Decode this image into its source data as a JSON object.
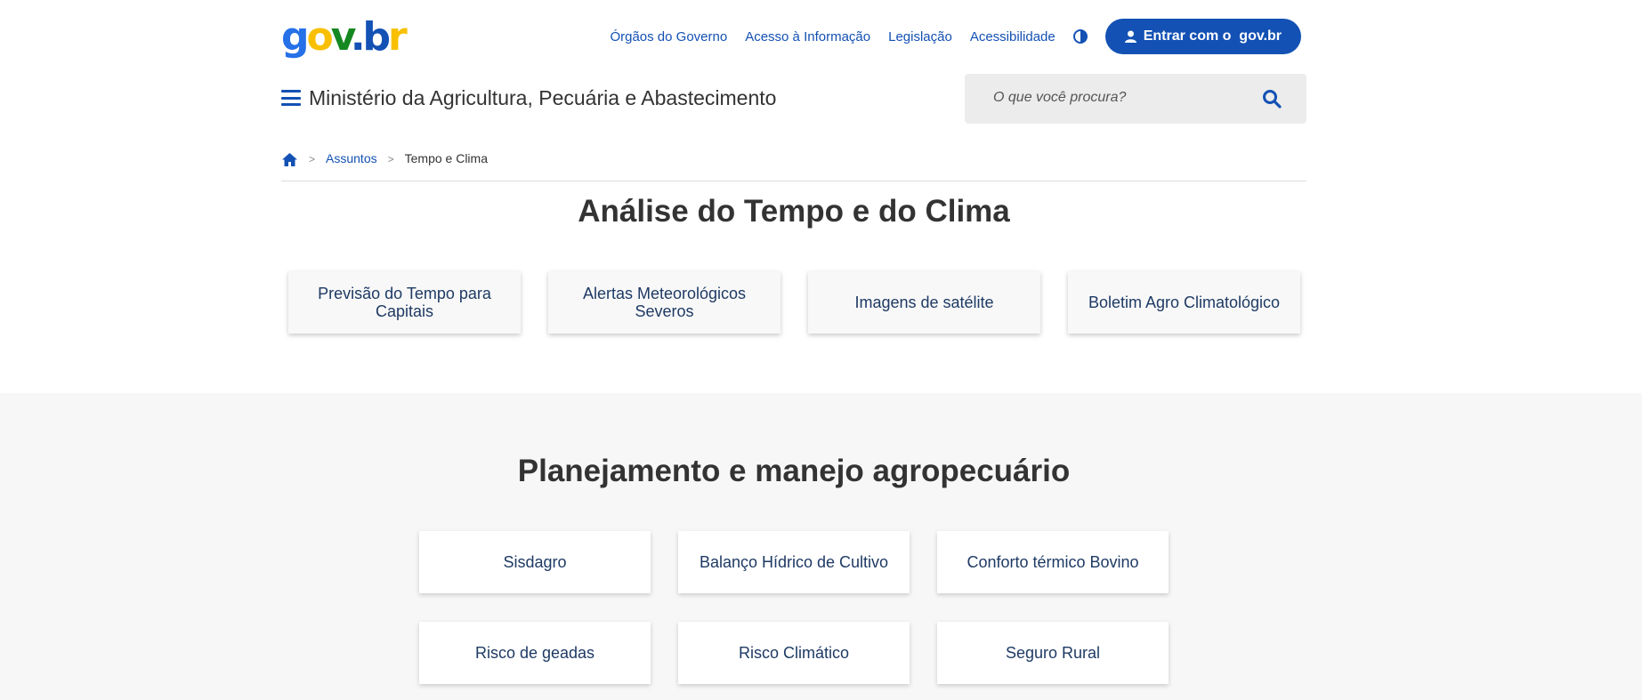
{
  "header": {
    "logo": {
      "g": "g",
      "o": "o",
      "v": "v",
      "dot": ".",
      "b": "b",
      "r": "r"
    },
    "links": [
      "Órgãos do Governo",
      "Acesso à Informação",
      "Legislação",
      "Acessibilidade"
    ],
    "login_label": "Entrar com o  gov.br",
    "org_title": "Ministério da Agricultura, Pecuária e Abastecimento",
    "search_placeholder": "O que você procura?"
  },
  "breadcrumb": {
    "items": [
      "Assuntos",
      "Tempo e Clima"
    ],
    "separator": ">"
  },
  "section1": {
    "title": "Análise do Tempo e do Clima",
    "cards": [
      "Previsão do Tempo para Capitais",
      "Alertas Meteorológicos Severos",
      "Imagens de satélite",
      "Boletim Agro Climatológico"
    ]
  },
  "section2": {
    "title": "Planejamento e manejo agropecuário",
    "cards": [
      "Sisdagro",
      "Balanço Hídrico de Cultivo",
      "Conforto térmico Bovino",
      "Risco de geadas",
      "Risco Climático",
      "Seguro Rural"
    ]
  },
  "colors": {
    "primary": "#1351b4",
    "text": "#333333",
    "card_text": "#1e3a64",
    "section_bg": "#f7f7f7"
  }
}
